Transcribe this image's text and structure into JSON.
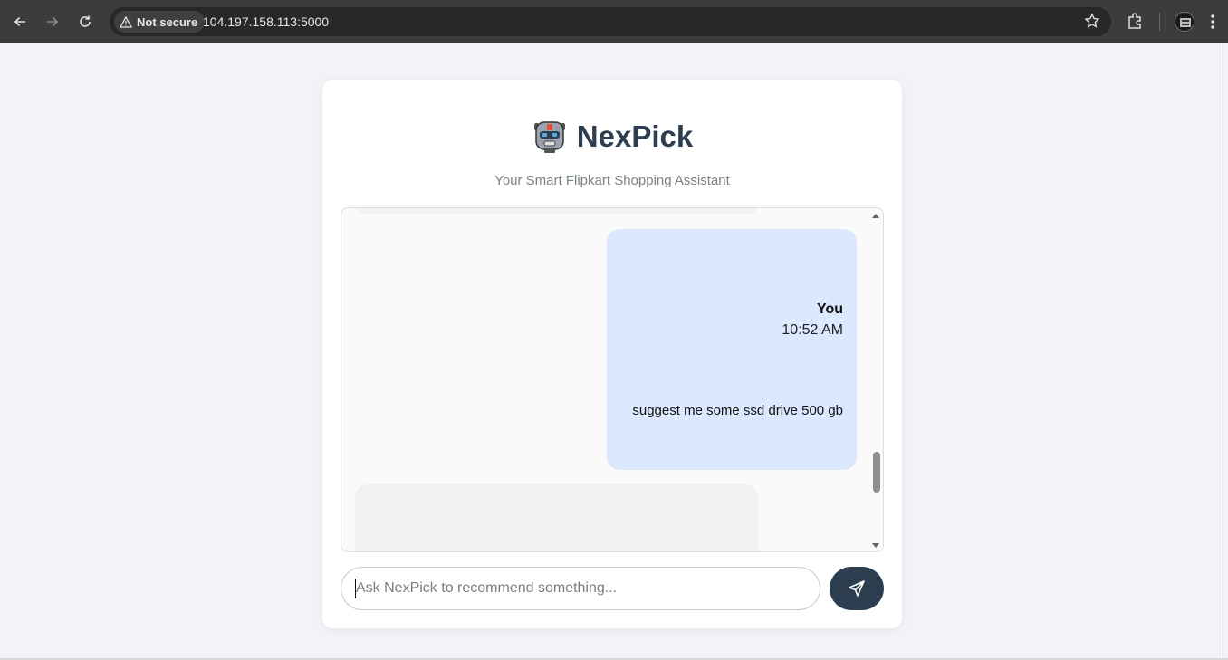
{
  "browser": {
    "security_label": "Not secure",
    "url": "104.197.158.113:5000"
  },
  "app": {
    "title": "NexPick",
    "subtitle": "Your Smart Flipkart Shopping Assistant",
    "brand_color": "#2c3e50"
  },
  "chat": {
    "messages": [
      {
        "sender": "You",
        "time": "10:52 AM",
        "text": "suggest me some ssd drive 500 gb",
        "bubble_color": "#dbe8fd"
      }
    ]
  },
  "composer": {
    "placeholder": "Ask NexPick to recommend something...",
    "value": "",
    "send_icon": "paper-plane-icon"
  }
}
